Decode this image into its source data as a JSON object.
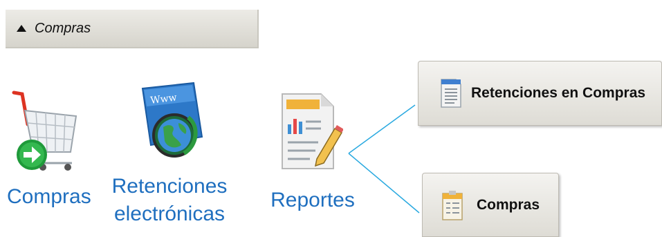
{
  "section": {
    "title": "Compras",
    "toggle_icon": "triangle-up-icon"
  },
  "modules": [
    {
      "label": "Compras",
      "icon": "shopping-cart-icon"
    },
    {
      "label_line1": "Retenciones",
      "label_line2": "electrónicas",
      "icon": "www-globe-icon"
    },
    {
      "label": "Reportes",
      "icon": "report-document-icon"
    }
  ],
  "reports": [
    {
      "label": "Retenciones en Compras",
      "icon": "document-list-icon"
    },
    {
      "label": "Compras",
      "icon": "document-form-icon"
    }
  ],
  "colors": {
    "link_blue": "#1f6fbf",
    "connector": "#29a9e0"
  }
}
